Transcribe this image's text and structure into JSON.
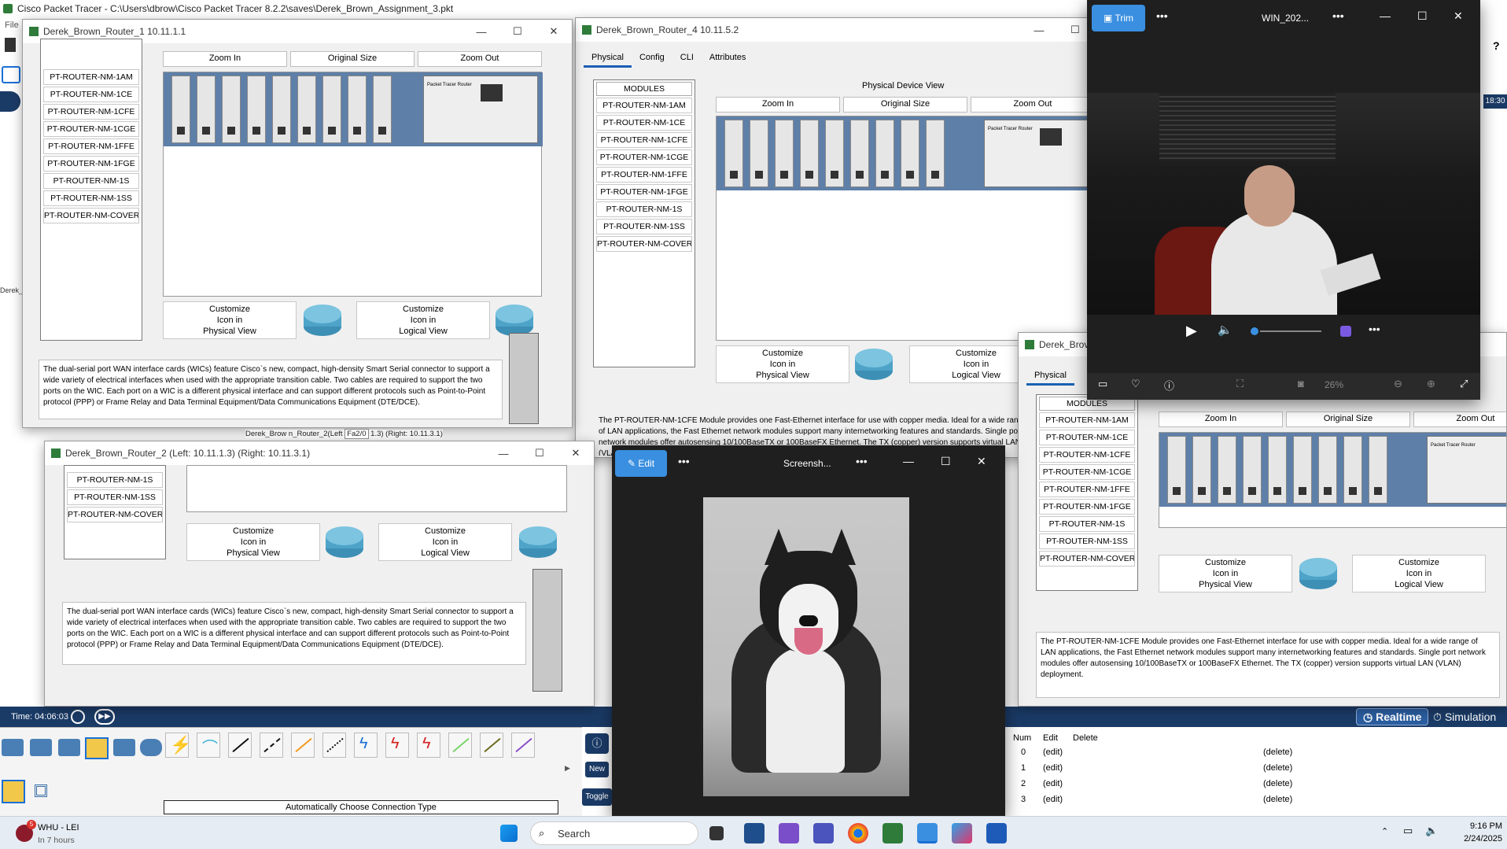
{
  "app": {
    "title": "Cisco Packet Tracer - C:\\Users\\dbrow\\Cisco Packet Tracer 8.2.2\\saves\\Derek_Brown_Assignment_3.pkt",
    "menu_file": "File",
    "side_label": "Derek_",
    "time_label": "Time: 04:06:03",
    "clock_right": "18:30",
    "realtime": "Realtime",
    "simulation": "Simulation",
    "connection_type": "Automatically Choose Connection Type",
    "new_btn": "New",
    "toggle_btn": "Toggle",
    "status_caption": "Derek_Brow n_Router_2(Left",
    "status_caption_mid": "Fa2/0",
    "status_caption_right": "1.3) (Right: 10.11.3.1)"
  },
  "common": {
    "modules_header": "MODULES",
    "modules": [
      "PT-ROUTER-NM-1AM",
      "PT-ROUTER-NM-1CE",
      "PT-ROUTER-NM-1CFE",
      "PT-ROUTER-NM-1CGE",
      "PT-ROUTER-NM-1FFE",
      "PT-ROUTER-NM-1FGE",
      "PT-ROUTER-NM-1S",
      "PT-ROUTER-NM-1SS",
      "PT-ROUTER-NM-COVER"
    ],
    "zoom_in": "Zoom In",
    "original_size": "Original Size",
    "zoom_out": "Zoom Out",
    "customize_physical": [
      "Customize",
      "Icon in",
      "Physical View"
    ],
    "customize_logical": [
      "Customize",
      "Icon in",
      "Logical View"
    ],
    "physical_device_view": "Physical Device View",
    "router_brand": "Packet Tracer Router",
    "desc_serial": "The dual-serial port WAN interface cards (WICs) feature Cisco`s new, compact, high-density Smart Serial connector to support a wide variety of electrical interfaces when used with the appropriate transition cable. Two cables are required to support the two ports on the WIC. Each port on a WIC is a different physical interface and can support different protocols such as Point-to-Point protocol (PPP) or Frame Relay and Data Terminal Equipment/Data Communications Equipment (DTE/DCE).",
    "desc_cfe": "The PT-ROUTER-NM-1CFE Module provides one Fast-Ethernet interface for use with copper media. Ideal for a wide range of LAN applications, the Fast Ethernet network modules support many internetworking features and standards. Single port network modules offer autosensing 10/100BaseTX or 100BaseFX Ethernet. The TX (copper) version supports virtual LAN (VLAN) deployment.",
    "tabs": [
      "Physical",
      "Config",
      "CLI",
      "Attributes"
    ]
  },
  "router1": {
    "title": "Derek_Brown_Router_1 10.11.1.1"
  },
  "router2": {
    "title": "Derek_Brown_Router_2 (Left: 10.11.1.3) (Right: 10.11.3.1)"
  },
  "router4": {
    "title": "Derek_Brown_Router_4 10.11.5.2"
  },
  "router_partial": {
    "title": "Derek_Brov"
  },
  "media_player": {
    "trim": "Trim",
    "filename": "WIN_202...",
    "zoom": "26%"
  },
  "photos": {
    "edit": "Edit",
    "filename": "Screensh..."
  },
  "sim_table": {
    "headers": [
      "Num",
      "Edit",
      "Delete"
    ],
    "rows": [
      {
        "num": "0",
        "edit": "(edit)",
        "delete": "(delete)"
      },
      {
        "num": "1",
        "edit": "(edit)",
        "delete": "(delete)"
      },
      {
        "num": "2",
        "edit": "(edit)",
        "delete": "(delete)"
      },
      {
        "num": "3",
        "edit": "(edit)",
        "delete": "(delete)"
      }
    ]
  },
  "taskbar": {
    "weather_badge": "5",
    "weather_title": "WHU - LEI",
    "weather_sub": "In 7 hours",
    "search": "Search",
    "time": "9:16 PM",
    "date": "2/24/2025"
  },
  "colors": {
    "accent_blue": "#1b6fd6",
    "pt_blue": "#1b3b67",
    "router_blue": "#5e7fa8",
    "player_bg": "#1f1f1f"
  }
}
